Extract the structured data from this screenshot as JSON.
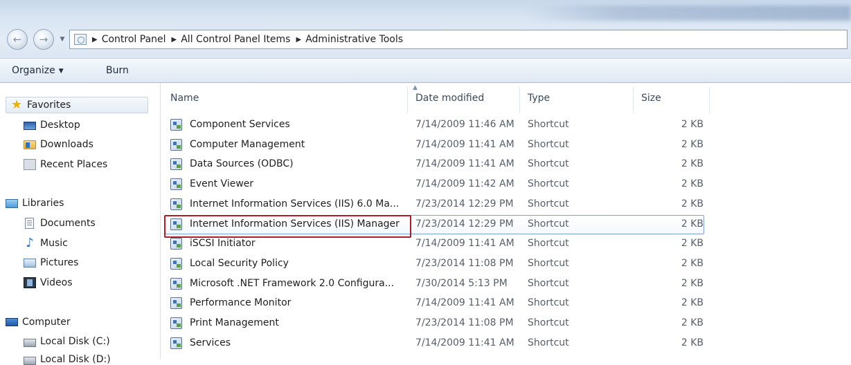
{
  "addressbar": {
    "breadcrumbs": [
      "Control Panel",
      "All Control Panel Items",
      "Administrative Tools"
    ]
  },
  "toolbar": {
    "organize_label": "Organize",
    "burn_label": "Burn"
  },
  "navpane": {
    "favorites": {
      "label": "Favorites",
      "items": [
        "Desktop",
        "Downloads",
        "Recent Places"
      ]
    },
    "libraries": {
      "label": "Libraries",
      "items": [
        "Documents",
        "Music",
        "Pictures",
        "Videos"
      ]
    },
    "computer": {
      "label": "Computer",
      "items": [
        "Local Disk (C:)",
        "Local Disk (D:)"
      ]
    }
  },
  "filelist": {
    "columns": [
      "Name",
      "Date modified",
      "Type",
      "Size"
    ],
    "sort_column": "Name",
    "selected_row": 5,
    "rows": [
      {
        "name": "Component Services",
        "date": "7/14/2009 11:46 AM",
        "type": "Shortcut",
        "size": "2 KB"
      },
      {
        "name": "Computer Management",
        "date": "7/14/2009 11:41 AM",
        "type": "Shortcut",
        "size": "2 KB"
      },
      {
        "name": "Data Sources (ODBC)",
        "date": "7/14/2009 11:41 AM",
        "type": "Shortcut",
        "size": "2 KB"
      },
      {
        "name": "Event Viewer",
        "date": "7/14/2009 11:42 AM",
        "type": "Shortcut",
        "size": "2 KB"
      },
      {
        "name": "Internet Information Services (IIS) 6.0 Ma...",
        "date": "7/23/2014 12:29 PM",
        "type": "Shortcut",
        "size": "2 KB"
      },
      {
        "name": "Internet Information Services (IIS) Manager",
        "date": "7/23/2014 12:29 PM",
        "type": "Shortcut",
        "size": "2 KB"
      },
      {
        "name": "iSCSI Initiator",
        "date": "7/14/2009 11:41 AM",
        "type": "Shortcut",
        "size": "2 KB"
      },
      {
        "name": "Local Security Policy",
        "date": "7/23/2014 11:08 PM",
        "type": "Shortcut",
        "size": "2 KB"
      },
      {
        "name": "Microsoft .NET Framework 2.0 Configura...",
        "date": "7/30/2014 5:13 PM",
        "type": "Shortcut",
        "size": "2 KB"
      },
      {
        "name": "Performance Monitor",
        "date": "7/14/2009 11:41 AM",
        "type": "Shortcut",
        "size": "2 KB"
      },
      {
        "name": "Print Management",
        "date": "7/23/2014 11:08 PM",
        "type": "Shortcut",
        "size": "2 KB"
      },
      {
        "name": "Services",
        "date": "7/14/2009 11:41 AM",
        "type": "Shortcut",
        "size": "2 KB"
      }
    ]
  },
  "colors": {
    "highlight_box": "#b01c2a",
    "selection_border": "#7da2ce"
  }
}
